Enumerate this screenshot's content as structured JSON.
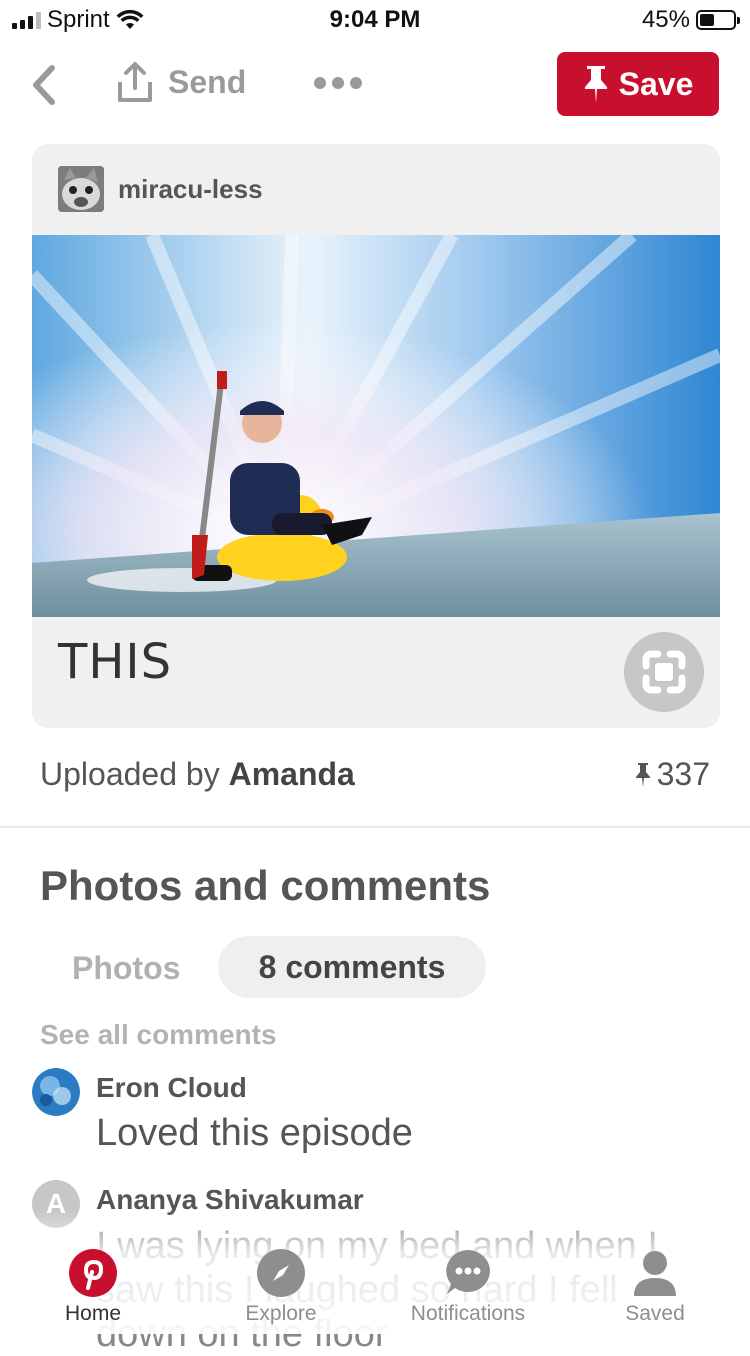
{
  "status_bar": {
    "carrier": "Sprint",
    "time": "9:04 PM",
    "battery": "45%",
    "battery_level": 0.45
  },
  "nav": {
    "send_label": "Send",
    "save_label": "Save"
  },
  "pin": {
    "author": "miracu-less",
    "caption": "THIS"
  },
  "meta": {
    "uploaded_prefix": "Uploaded by",
    "uploader": "Amanda",
    "save_count": "337"
  },
  "comments_section": {
    "title": "Photos and comments",
    "tab_photos": "Photos",
    "tab_comments": "8 comments",
    "see_all": "See all comments",
    "items": [
      {
        "author": "Eron Cloud",
        "text": "Loved this episode"
      },
      {
        "author": "Ananya Shivakumar",
        "avatar_letter": "A",
        "text": "I was lying on my bed and when I saw this I laughed so hard I fell down on the floor"
      }
    ]
  },
  "tabbar": {
    "items": [
      {
        "label": "Home",
        "icon": "pinterest-logo-icon"
      },
      {
        "label": "Explore",
        "icon": "compass-icon"
      },
      {
        "label": "Notifications",
        "icon": "speech-bubble-icon"
      },
      {
        "label": "Saved",
        "icon": "profile-icon"
      }
    ]
  },
  "colors": {
    "brand_red": "#c8102e",
    "muted_gray": "#9a9a9a"
  }
}
